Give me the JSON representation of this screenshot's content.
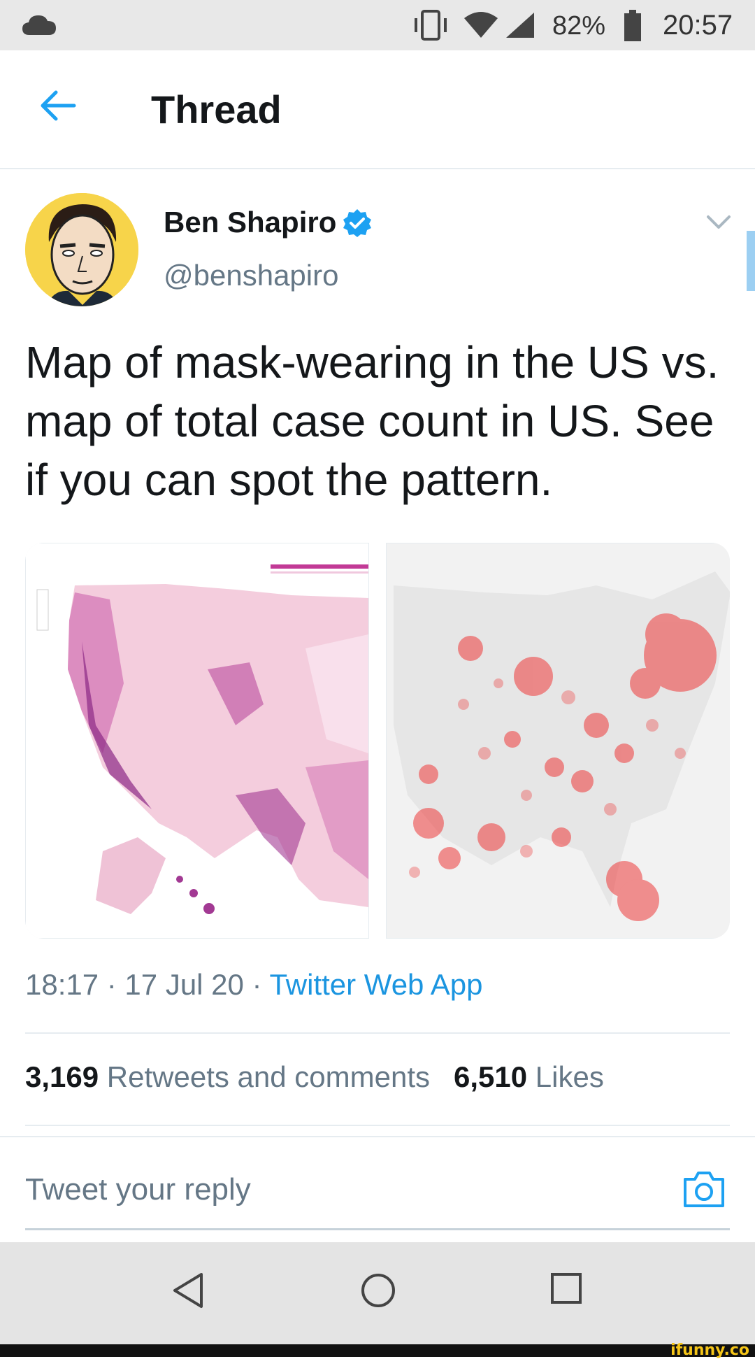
{
  "status_bar": {
    "battery_percent": "82%",
    "time": "20:57",
    "icons": [
      "cloud-icon",
      "vibrate-icon",
      "wifi-icon",
      "cell-signal-icon",
      "battery-icon"
    ]
  },
  "header": {
    "title": "Thread",
    "back_icon": "arrow-left-icon"
  },
  "tweet": {
    "author_name": "Ben Shapiro",
    "handle": "@benshapiro",
    "verified": true,
    "text": "Map of mask-wearing in the US vs. map of total case count in US. See if you can spot the pattern.",
    "timestamp": "18:17 · 17 Jul 20 · ",
    "source": "Twitter Web App",
    "retweets_count": "3,169",
    "retweets_label": "Retweets and comments",
    "likes_count": "6,510",
    "likes_label": "Likes"
  },
  "reply": {
    "placeholder": "Tweet your reply",
    "camera_icon": "camera-icon"
  },
  "nav": {
    "icons": [
      "nav-back-icon",
      "nav-home-icon",
      "nav-recents-icon"
    ]
  },
  "watermark": "ifunny.co",
  "colors": {
    "accent": "#1da1f2",
    "link": "#1b95e0",
    "secondary_text": "#657786",
    "mask_map": "#b0308f",
    "case_map": "#e8302a"
  }
}
